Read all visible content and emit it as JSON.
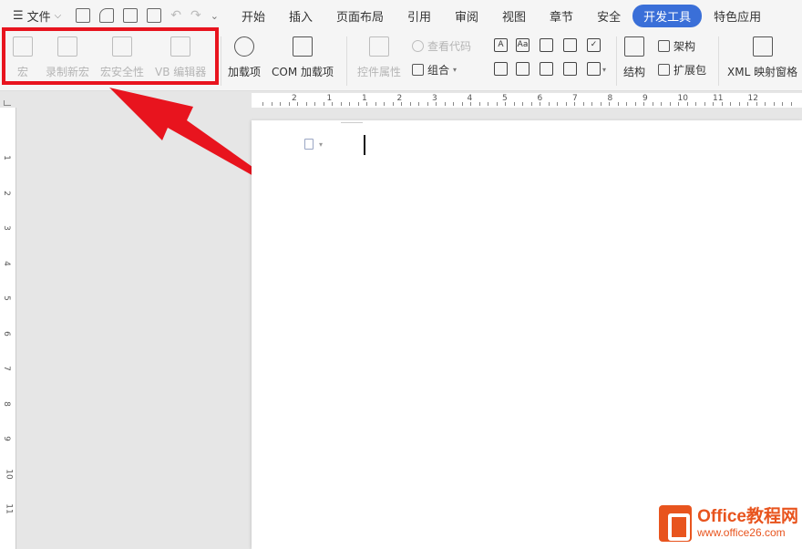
{
  "menubar": {
    "file_label": "文件",
    "tabs": [
      "开始",
      "插入",
      "页面布局",
      "引用",
      "审阅",
      "视图",
      "章节",
      "安全",
      "开发工具",
      "特色应用"
    ],
    "active_tab": "开发工具"
  },
  "ribbon": {
    "macro": "宏",
    "record_macro": "录制新宏",
    "macro_security": "宏安全性",
    "vb_editor": "VB 编辑器",
    "addins": "加载项",
    "com_addins": "COM 加载项",
    "control_props": "控件属性",
    "view_code": "查看代码",
    "group": "组合",
    "structure": "结构",
    "schema": "架构",
    "expansion_pack": "扩展包",
    "xml_pane": "XML 映射窗格"
  },
  "ruler": {
    "h_numbers": [
      "2",
      "1",
      "1",
      "2",
      "3",
      "4",
      "5",
      "6",
      "7",
      "8",
      "9",
      "10",
      "11",
      "12"
    ],
    "v_numbers": [
      "1",
      "2",
      "3",
      "4",
      "5",
      "6",
      "7",
      "8",
      "9",
      "10",
      "11"
    ]
  },
  "watermark": {
    "title": "Office教程网",
    "url": "www.office26.com"
  },
  "colors": {
    "accent": "#3a6fd8",
    "highlight": "#e8141e",
    "brand": "#e8541e"
  }
}
